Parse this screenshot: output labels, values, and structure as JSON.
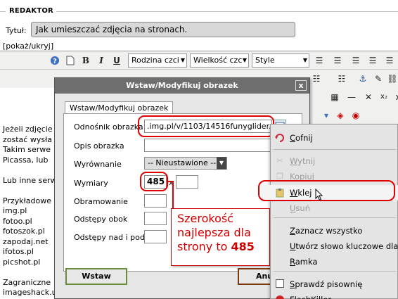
{
  "editor_section": {
    "heading": "REDAKTOR",
    "title_label": "Tytuł:",
    "title_value": "Jak umieszczać zdjęcia na stronach.",
    "toggle_link": "[pokaż/ukryj]"
  },
  "toolbar": {
    "font_family": "Rodzina czci",
    "font_size": "Wielkość czc",
    "style": "Style",
    "bold": "B",
    "italic": "I",
    "underline": "U"
  },
  "editor_body_lines": [
    "Jeżeli zdjęcie",
    "zostać wysła",
    "Takim serwe",
    "Picassa, lub",
    "",
    "Lub inne serw",
    "",
    "Przykładowe",
    "img.pl",
    "fotoo.pl",
    "fotoszok.pl",
    "zapodaj.net",
    "ifotos.pl",
    "picshot.pl",
    "",
    "Zagraniczne",
    "imageshack.us"
  ],
  "dialog": {
    "title": "Wstaw/Modyfikuj obrazek",
    "close": "x",
    "tab": "Wstaw/Modyfikuj obrazek",
    "fields": {
      "url_label": "Odnośnik obrazka",
      "url_value": ".img.pl/v/1103/14516funyglider.jpg",
      "description_label": "Opis obrazka",
      "description_value": "",
      "alignment_label": "Wyrównanie",
      "alignment_value": "-- Nieustawione --",
      "dimensions_label": "Wymiary",
      "width_value": "485",
      "dimension_separator": "x",
      "height_value": "",
      "border_label": "Obramowanie",
      "hspace_label": "Odstępy obok",
      "vspace_label": "Odstępy nad i pod"
    },
    "insert_button": "Wstaw",
    "cancel_button": "Anu"
  },
  "annotation": {
    "line1": "Szerokość",
    "line2": "najlepsza dla",
    "line3_prefix": "strony to ",
    "line3_value": "485"
  },
  "context_menu": {
    "items": [
      {
        "label": "Cofnij",
        "icon": "undo-icon",
        "enabled": true
      },
      {
        "label": "Wytnij",
        "icon": "cut-icon",
        "enabled": false
      },
      {
        "label": "Kopiuj",
        "icon": "copy-icon",
        "enabled": false
      },
      {
        "label": "Wklej",
        "icon": "paste-icon",
        "enabled": true,
        "highlighted": true
      },
      {
        "label": "Usuń",
        "icon": "",
        "enabled": false
      },
      {
        "label": "Zaznacz wszystko",
        "icon": "",
        "enabled": true
      },
      {
        "label": "Utwórz słowo kluczowe dla te",
        "icon": "",
        "enabled": true
      },
      {
        "label": "Ramka",
        "icon": "",
        "enabled": true
      },
      {
        "label": "Sprawdź pisownię",
        "icon": "checkbox-icon",
        "enabled": true
      },
      {
        "label": "FlashKiller",
        "icon": "flashkiller-icon",
        "enabled": true
      }
    ]
  },
  "colors": {
    "highlight_red": "#e00000",
    "dialog_title_bg": "#6e6e6e",
    "insert_border": "#6a8b3a"
  }
}
